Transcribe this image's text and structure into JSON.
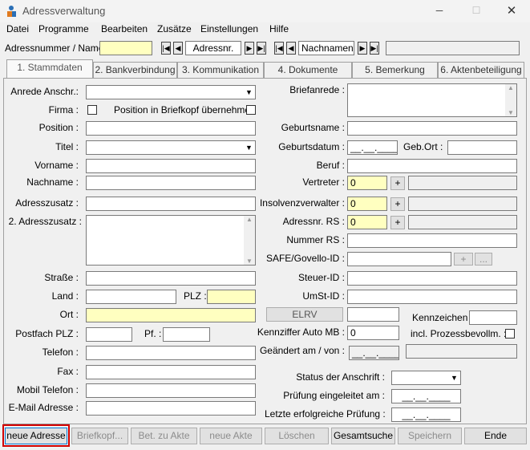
{
  "window": {
    "title": "Adressverwaltung"
  },
  "menu": [
    "Datei",
    "Programme",
    "Bearbeiten",
    "Zusätze",
    "Einstellungen",
    "Hilfe"
  ],
  "nav": {
    "label": "Adressnummer / Name :",
    "adressnr_label": "Adressnr.",
    "nachname_label": "Nachnamen"
  },
  "tabs": [
    "1. Stammdaten",
    "2. Bankverbindung",
    "3. Kommunikation",
    "4. Dokumente",
    "5. Bemerkung",
    "6. Aktenbeteiligung"
  ],
  "left": {
    "anrede": "Anrede Anschr.:",
    "firma": "Firma :",
    "position_briefkopf": "Position in Briefkopf übernehmen",
    "position": "Position :",
    "titel": "Titel :",
    "vorname": "Vorname :",
    "nachname": "Nachname :",
    "adresszusatz": "Adresszusatz :",
    "adresszusatz2": "2. Adresszusatz :",
    "strasse": "Straße :",
    "land": "Land :",
    "plz": "PLZ :",
    "ort": "Ort :",
    "postfach_plz": "Postfach  PLZ :",
    "pf": "Pf. :",
    "telefon": "Telefon :",
    "fax": "Fax :",
    "mobil": "Mobil Telefon :",
    "email": "E-Mail Adresse :"
  },
  "right": {
    "briefanrede": "Briefanrede :",
    "geburtsname": "Geburtsname :",
    "geburtsdatum": "Geburtsdatum :",
    "geburtsdatum_value": "__.__.____",
    "geb_ort": "Geb.Ort :",
    "beruf": "Beruf :",
    "vertreter": "Vertreter :",
    "vertreter_value": "0",
    "insolvenz": "Insolvenzverwalter :",
    "insolvenz_value": "0",
    "adressnr_rs": "Adressnr. RS :",
    "adressnr_rs_value": "0",
    "nummer_rs": "Nummer RS :",
    "safe": "SAFE/Govello-ID :",
    "steuer": "Steuer-ID :",
    "umst": "UmSt-ID :",
    "elrv": "ELRV",
    "kennzeichen": "Kennzeichen :",
    "kennziffer": "Kennziffer Auto MB :",
    "kennziffer_value": "0",
    "prozess": "incl. Prozessbevollm. :",
    "geaendert": "Geändert am / von :",
    "geaendert_value": "__.__.____",
    "status": "Status der Anschrift :",
    "pruefung": "Prüfung eingeleitet am :",
    "pruefung_value": "__.__.____",
    "letzte": "Letzte erfolgreiche Prüfung :",
    "letzte_value": "__.__.____",
    "plus": "+",
    "dots": "..."
  },
  "buttons": [
    "neue Adresse",
    "Briefkopf...",
    "Bet. zu Akte",
    "neue Akte",
    "Löschen",
    "Gesamtsuche",
    "Speichern",
    "Ende"
  ]
}
